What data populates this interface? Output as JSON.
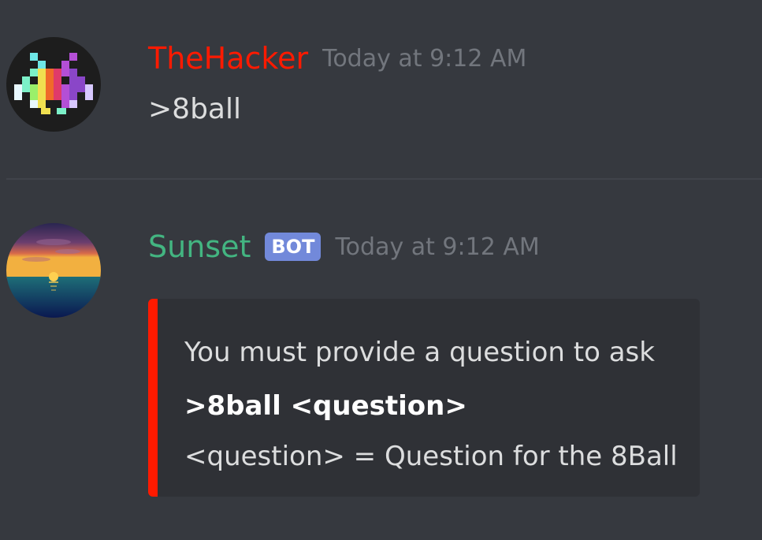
{
  "messages": [
    {
      "author": "TheHacker",
      "author_color": "#ff1a00",
      "timestamp": "Today at 9:12 AM",
      "content": ">8ball",
      "avatar_icon": "space-invader-icon"
    },
    {
      "author": "Sunset",
      "author_color": "#43b581",
      "bot_tag": "BOT",
      "timestamp": "Today at 9:12 AM",
      "avatar_icon": "sunset-icon",
      "embed": {
        "color": "#ff1a00",
        "description": "You must provide a question to ask",
        "field_name": ">8ball <question>",
        "field_value": "<question> = Question for the 8Ball"
      }
    }
  ]
}
